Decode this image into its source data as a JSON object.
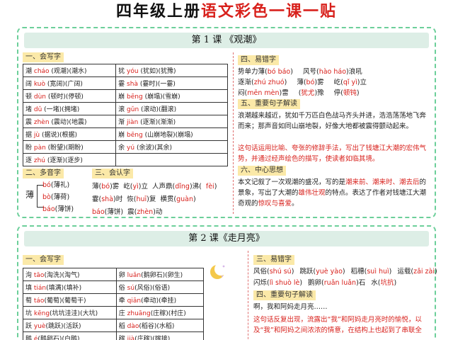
{
  "header": {
    "title_black": "四年级上册",
    "title_red": "语文彩色一课一贴"
  },
  "lesson1": {
    "heading": "第 1 课 《观潮》",
    "write": {
      "label": "一、会写字",
      "rows": [
        [
          {
            "a": "潮 ",
            "p": "cháo",
            "b": " (观潮)(潮水)"
          },
          {
            "a": "犹 ",
            "p": "yóu",
            "b": " (犹如)(犹豫)"
          }
        ],
        [
          {
            "a": "阔 ",
            "p": "kuò",
            "b": " (宽阔)(广阔)"
          },
          {
            "a": "霎 ",
            "p": "shà",
            "b": " (霎时)(一霎)"
          }
        ],
        [
          {
            "a": "顿 ",
            "p": "dùn",
            "b": " (顿时)(停顿)"
          },
          {
            "a": "崩 ",
            "p": "bēng",
            "b": " (崩塌)(雪崩)"
          }
        ],
        [
          {
            "a": "堵 ",
            "p": "dǔ",
            "b": " (一堵)(拥堵)"
          },
          {
            "a": "滚 ",
            "p": "gǔn",
            "b": " (滚动)(翻滚)"
          }
        ],
        [
          {
            "a": "震 ",
            "p": "zhèn",
            "b": " (震动)(地震)"
          },
          {
            "a": "渐 ",
            "p": "jiàn",
            "b": " (逐渐)(渐渐)"
          }
        ],
        [
          {
            "a": "据 ",
            "p": "jù",
            "b": " (据说)(根据)"
          },
          {
            "a": "崩 ",
            "p": "bēng",
            "b": " (山崩地裂)(崩塌)"
          }
        ],
        [
          {
            "a": "盼 ",
            "p": "pàn",
            "b": " (盼望)(期盼)"
          },
          {
            "a": "余 ",
            "p": "yú",
            "b": " (余波)(其余)"
          }
        ],
        [
          {
            "a": "逐 ",
            "p": "zhú",
            "b": " (逐渐)(逐步)"
          },
          {
            "a": "",
            "p": "",
            "b": ""
          }
        ]
      ]
    },
    "poly": {
      "label": "二、多音字",
      "char": "薄",
      "items": [
        {
          "p": "bó",
          "t": "(薄礼)"
        },
        {
          "p": "bò",
          "t": "(薄荷)"
        },
        {
          "p": "báo",
          "t": "(薄饼)"
        }
      ]
    },
    "recog": {
      "label": "三、会认字",
      "lines": [
        [
          {
            "a": "薄(",
            "p": "bó",
            "b": ")雾"
          },
          {
            "a": "屹(",
            "p": "yì",
            "b": ")立"
          },
          {
            "a": "人声鼎(",
            "p": "dǐng",
            "b": ")沸("
          },
          {
            "a": "",
            "p": "fèi",
            "b": ")"
          }
        ],
        [
          {
            "a": "霎(",
            "p": "shà",
            "b": ")时"
          },
          {
            "a": "恢(",
            "p": "huī",
            "b": ")复"
          },
          {
            "a": "横贯(",
            "p": "guàn",
            "b": ")"
          }
        ],
        [
          {
            "a": "",
            "p": "báo",
            "b": "(薄饼)"
          },
          {
            "a": "震(",
            "p": "zhèn",
            "b": ")动"
          }
        ]
      ]
    },
    "typo": {
      "label": "四、易错字",
      "lines": [
        [
          {
            "a": "势单力薄(",
            "p": "bó báo",
            "b": ")"
          },
          {
            "a": "风号(",
            "p": "hào háo",
            "b": ")浪吼"
          }
        ],
        [
          {
            "a": "逐渐(",
            "p": "zhú zhuó",
            "b": ")"
          },
          {
            "a": "薄(",
            "p": "bó",
            "b": ")雾"
          },
          {
            "a": "屹(",
            "p": "qǐ yì",
            "b": ")立"
          }
        ],
        [
          {
            "a": "闷(",
            "p": "mēn mèn",
            "b": ")雷"
          },
          {
            "a": "(",
            "p": "犹尤",
            "b": ")豫"
          },
          {
            "a": "停(",
            "p": "顿钝",
            "b": ")"
          }
        ]
      ]
    },
    "sentence": {
      "label": "五、重要句子解读",
      "quote": "浪潮越来越近，犹如千万匹白色战马齐头并进，浩浩荡荡地飞奔而来；那声音如同山崩地裂，好像大地都被震得颤动起来。",
      "explain": "这句话运用比喻、夸张的修辞手法，写出了钱塘江大潮的宏伟气势，并通过经声绘色的描写，使读者如临其境。"
    },
    "center": {
      "label": "六、中心思想",
      "p1": "本文记叙了一次观潮的盛况，写的是",
      "r1": "潮来前、潮来时、潮去后",
      "p2": "的景象，写出了大潮的",
      "r2": "雄伟壮观",
      "p3": "的特点。表达了作者对钱塘江大潮奇观的",
      "r3": "惊叹与喜爱",
      "p4": "。"
    }
  },
  "lesson2": {
    "heading": "第 2 课《走月亮》",
    "moon_icon": "crescent-moon-icon",
    "write": {
      "label": "一、会写字",
      "rows": [
        [
          {
            "a": "洵 ",
            "p": "tāo",
            "b": "(淘洗)(淘气)"
          },
          {
            "a": "卵 ",
            "p": "luǎn",
            "b": "(鹅卵石)(卵生)"
          }
        ],
        [
          {
            "a": "填 ",
            "p": "tián",
            "b": "(填满)(填补)"
          },
          {
            "a": "俗 ",
            "p": "sú",
            "b": "(风俗)(俗语)"
          }
        ],
        [
          {
            "a": "萄 ",
            "p": "táo",
            "b": "(葡萄)(葡萄干)"
          },
          {
            "a": "牵 ",
            "p": "qiān",
            "b": "(牵动)(牵挂)"
          }
        ],
        [
          {
            "a": "坑 ",
            "p": "kēng",
            "b": "(坑坑洼洼)(大坑)"
          },
          {
            "a": "庄 ",
            "p": "zhuāng",
            "b": "(庄稼)(村庄)"
          }
        ],
        [
          {
            "a": "跃 ",
            "p": "yuè",
            "b": "(跳跃)(活跃)"
          },
          {
            "a": "稻 ",
            "p": "dào",
            "b": "(稻谷)(水稻)"
          }
        ],
        [
          {
            "a": "鹅 ",
            "p": "é",
            "b": "(鹅卵石)(白鹅)"
          },
          {
            "a": "稼 ",
            "p": "jià",
            "b": "(庄稼)(嫁接)"
          }
        ]
      ]
    },
    "typo": {
      "label": "三、易错字",
      "lines": [
        [
          {
            "a": "风俗(",
            "p": "shú sú",
            "b": ")"
          },
          {
            "a": "跳跃(",
            "p": "yuè yào",
            "b": ")"
          },
          {
            "a": "稻穗(",
            "p": "suì huì",
            "b": ")"
          },
          {
            "a": "运载(",
            "p": "zǎi zài",
            "b": ")"
          }
        ],
        [
          {
            "a": "闪烁(",
            "p": "lì shuò lè",
            "b": ")"
          },
          {
            "a": "鹅卵(",
            "p": "ruǎn luǎn",
            "b": ")石"
          },
          {
            "a": "水(",
            "p": "坑抗",
            "b": ")"
          }
        ]
      ]
    },
    "sentence": {
      "label": "四、重要句子解读",
      "quote": "啊，我和阿妈走月亮……",
      "explain": "这句话反复出现，流露出“我”和阿妈走月亮时的愉悦，以及“我”和阿妈之间浓浓的情意，在结构上也起到了串联全"
    }
  }
}
